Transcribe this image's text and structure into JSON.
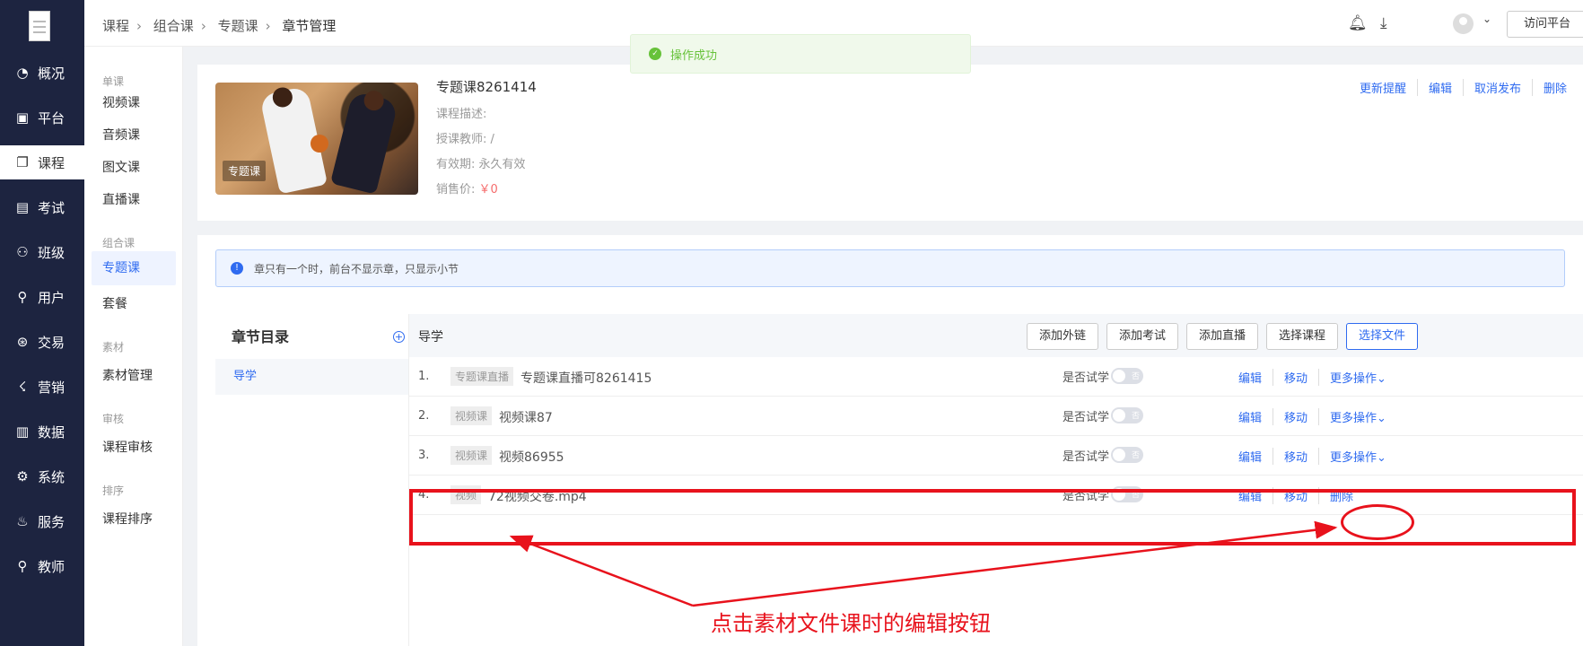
{
  "nav": {
    "items": [
      {
        "label": "概况",
        "icon": "dashboard-icon",
        "glyph": "◔"
      },
      {
        "label": "平台",
        "icon": "platform-icon",
        "glyph": "▣"
      },
      {
        "label": "课程",
        "icon": "book-icon",
        "glyph": "❐",
        "active": true
      },
      {
        "label": "考试",
        "icon": "exam-icon",
        "glyph": "▤"
      },
      {
        "label": "班级",
        "icon": "class-icon",
        "glyph": "⚇"
      },
      {
        "label": "用户",
        "icon": "user-icon",
        "glyph": "⚲"
      },
      {
        "label": "交易",
        "icon": "transaction-icon",
        "glyph": "⊛"
      },
      {
        "label": "营销",
        "icon": "megaphone-icon",
        "glyph": "☇"
      },
      {
        "label": "数据",
        "icon": "chart-icon",
        "glyph": "▥"
      },
      {
        "label": "系统",
        "icon": "gear-icon",
        "glyph": "⚙"
      },
      {
        "label": "服务",
        "icon": "service-icon",
        "glyph": "♨"
      },
      {
        "label": "教师",
        "icon": "teacher-icon",
        "glyph": "⚲"
      }
    ]
  },
  "submenu": {
    "groups": [
      {
        "title": "单课",
        "items": [
          "视频课",
          "音频课",
          "图文课",
          "直播课"
        ]
      },
      {
        "title": "组合课",
        "items": [
          "专题课",
          "套餐"
        ]
      },
      {
        "title": "素材",
        "items": [
          "素材管理"
        ]
      },
      {
        "title": "审核",
        "items": [
          "课程审核"
        ]
      },
      {
        "title": "排序",
        "items": [
          "课程排序"
        ]
      }
    ],
    "active": "专题课"
  },
  "header": {
    "breadcrumb": [
      "课程",
      "组合课",
      "专题课",
      "章节管理"
    ],
    "visit_label": "访问平台"
  },
  "toast": {
    "text": "操作成功"
  },
  "course": {
    "title": "专题课8261414",
    "description": "课程描述:",
    "teacher": "授课教师: /",
    "validity": "有效期: 永久有效",
    "price_label": "销售价:",
    "price": "￥0",
    "thumb_tag": "专题课",
    "actions": [
      "更新提醒",
      "编辑",
      "取消发布",
      "删除"
    ]
  },
  "notice": {
    "text": "章只有一个时，前台不显示章，只显示小节"
  },
  "toc": {
    "title": "章节目录",
    "chapters": [
      "导学"
    ]
  },
  "chapter": {
    "title": "导学",
    "buttons": [
      "添加外链",
      "添加考试",
      "添加直播",
      "选择课程",
      "选择文件"
    ]
  },
  "lessons": [
    {
      "num": "1.",
      "type": "专题课直播",
      "name": "专题课直播可8261415",
      "trial_label": "是否试学",
      "switch": "否",
      "ops": [
        "编辑",
        "移动",
        "更多操作⌄"
      ]
    },
    {
      "num": "2.",
      "type": "视频课",
      "name": "视频课87",
      "trial_label": "是否试学",
      "switch": "否",
      "ops": [
        "编辑",
        "移动",
        "更多操作⌄"
      ]
    },
    {
      "num": "3.",
      "type": "视频课",
      "name": "视频86955",
      "trial_label": "是否试学",
      "switch": "否",
      "ops": [
        "编辑",
        "移动",
        "更多操作⌄"
      ]
    },
    {
      "num": "4.",
      "type": "视频",
      "name": "72视频交卷.mp4",
      "trial_label": "是否试学",
      "switch": "否",
      "ops": [
        "编辑",
        "移动",
        "删除"
      ]
    }
  ],
  "annotation": {
    "text": "点击素材文件课时的编辑按钮",
    "color": "#e8121c"
  },
  "colors": {
    "nav_bg": "#1d2440",
    "accent": "#2f6bf0",
    "success": "#67c23a",
    "price": "#f56c6c"
  }
}
